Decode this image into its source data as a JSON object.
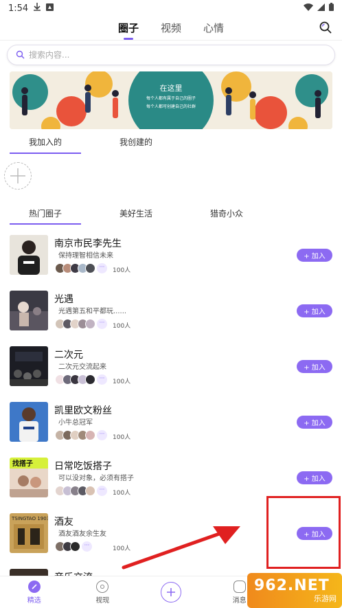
{
  "status_bar": {
    "time": "1:54"
  },
  "top_tabs": [
    {
      "label": "圈子",
      "active": true
    },
    {
      "label": "视频",
      "active": false
    },
    {
      "label": "心情",
      "active": false
    }
  ],
  "search": {
    "placeholder": "搜索内容..."
  },
  "banner": {
    "title": "在这里",
    "line1": "每个人都有属于自己的圈子",
    "line2": "每个人都可创建自己的社群"
  },
  "my_tabs": [
    {
      "label": "我加入的",
      "active": true
    },
    {
      "label": "我创建的",
      "active": false
    }
  ],
  "hot_tabs": [
    {
      "label": "热门圈子",
      "active": true
    },
    {
      "label": "美好生活",
      "active": false
    },
    {
      "label": "猎奇小众",
      "active": false
    }
  ],
  "circles": [
    {
      "name": "南京市民李先生",
      "desc": "保持理智相信未来",
      "count": "100人",
      "join": "+ 加入"
    },
    {
      "name": "光遇",
      "desc": "光遇第五和平都玩......",
      "count": "100人",
      "join": "+ 加入"
    },
    {
      "name": "二次元",
      "desc": "二次元交流起来",
      "count": "100人",
      "join": "+ 加入"
    },
    {
      "name": "凯里欧文粉丝",
      "desc": "小牛总冠军",
      "count": "100人",
      "join": "+ 加入"
    },
    {
      "name": "日常吃饭搭子",
      "desc": "可以没对象，必须有搭子",
      "count": "100人",
      "join": "+ 加入"
    },
    {
      "name": "酒友",
      "desc": "酒友酒友余生友",
      "count": "100人",
      "join": "+ 加入"
    },
    {
      "name": "音乐交流",
      "desc": "",
      "count": "",
      "join": ""
    }
  ],
  "thumb_text": {
    "c5": "找搭子",
    "c6": "TSINGTAO 1903"
  },
  "bottom_nav": [
    {
      "label": "精选",
      "active": true
    },
    {
      "label": "视现",
      "active": false
    },
    {
      "label": "",
      "active": false
    },
    {
      "label": "消息",
      "active": false
    },
    {
      "label": "",
      "active": false
    }
  ],
  "watermark": {
    "main": "962.NET",
    "sub": "乐游网"
  },
  "colors": {
    "accent": "#7b5cf0",
    "join_button": "#8c6af2",
    "annotation_red": "#e02020"
  }
}
